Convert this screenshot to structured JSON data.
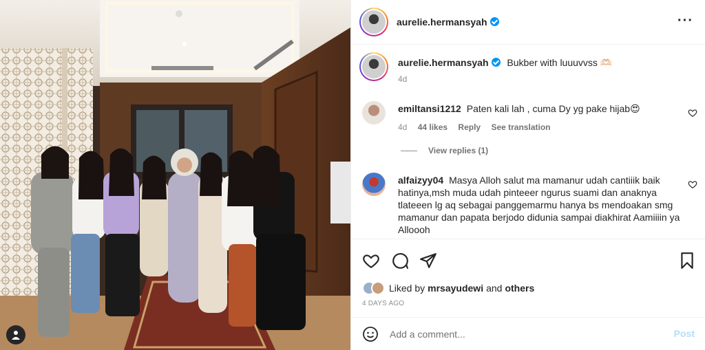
{
  "post": {
    "author": "aurelie.hermansyah",
    "caption": "Bukber with luuuvvss 🫶🏻",
    "caption_time": "4d",
    "liked_by_prefix": "Liked by",
    "liked_by_user": "mrsayudewi",
    "liked_by_and": "and",
    "liked_by_others": "others",
    "date": "4 DAYS AGO"
  },
  "comments": [
    {
      "user": "emiltansi1212",
      "text": "Paten kali lah , cuma Dy yg pake hijab😍",
      "time": "4d",
      "likes": "44 likes",
      "reply": "Reply",
      "translate": "See translation",
      "view_replies": "View replies (1)"
    },
    {
      "user": "alfaizyy04",
      "text": "Masya Alloh salut ma mamanur udah cantiiik baik hatinya,msh muda udah pinteeer ngurus suami dan anaknya tlateeen lg aq sebagai panggemarmu hanya bs mendoakan smg mamanur dan papata berjodo didunia sampai diakhirat Aamiiiin ya Alloooh"
    }
  ],
  "composer": {
    "placeholder": "Add a comment...",
    "post_label": "Post"
  },
  "icons": {
    "more": "more-options-icon",
    "like": "heart-icon",
    "comment": "comment-icon",
    "share": "share-icon",
    "save": "bookmark-icon",
    "emoji": "emoji-icon",
    "tag": "user-tag-icon"
  },
  "colors": {
    "verified": "#0095f6",
    "post_disabled": "#b2dffc",
    "secondary_text": "#8e8e8e"
  }
}
